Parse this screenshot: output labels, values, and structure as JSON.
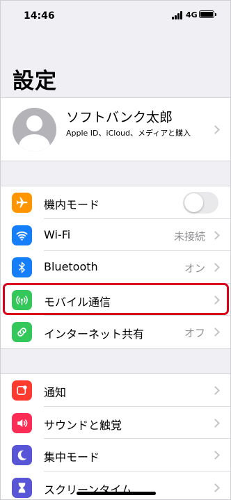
{
  "status_bar": {
    "time": "14:46",
    "network": "4G"
  },
  "page": {
    "title": "設定"
  },
  "profile": {
    "name": "ソフトバンク太郎",
    "subtitle": "Apple ID、iCloud、メディアと購入"
  },
  "group1": [
    {
      "label": "機内モード",
      "icon": "airplane-icon",
      "color": "#ff9500",
      "control": "toggle",
      "toggle_on": false
    },
    {
      "label": "Wi-Fi",
      "icon": "wifi-icon",
      "color": "#147efb",
      "value": "未接続"
    },
    {
      "label": "Bluetooth",
      "icon": "bluetooth-icon",
      "color": "#147efb",
      "value": "オン"
    },
    {
      "label": "モバイル通信",
      "icon": "antenna-icon",
      "color": "#34c759",
      "highlighted": true
    },
    {
      "label": "インターネット共有",
      "icon": "link-icon",
      "color": "#34c759",
      "value": "オフ"
    }
  ],
  "group2": [
    {
      "label": "通知",
      "icon": "notification-icon",
      "color": "#ff3b30"
    },
    {
      "label": "サウンドと触覚",
      "icon": "speaker-icon",
      "color": "#ff2d55"
    },
    {
      "label": "集中モード",
      "icon": "moon-icon",
      "color": "#5856d6"
    },
    {
      "label": "スクリーンタイム",
      "icon": "hourglass-icon",
      "color": "#5856d6"
    }
  ],
  "colors": {
    "background": "#efeff4",
    "highlight_border": "#d9001c",
    "value_text": "#8e8e93"
  }
}
